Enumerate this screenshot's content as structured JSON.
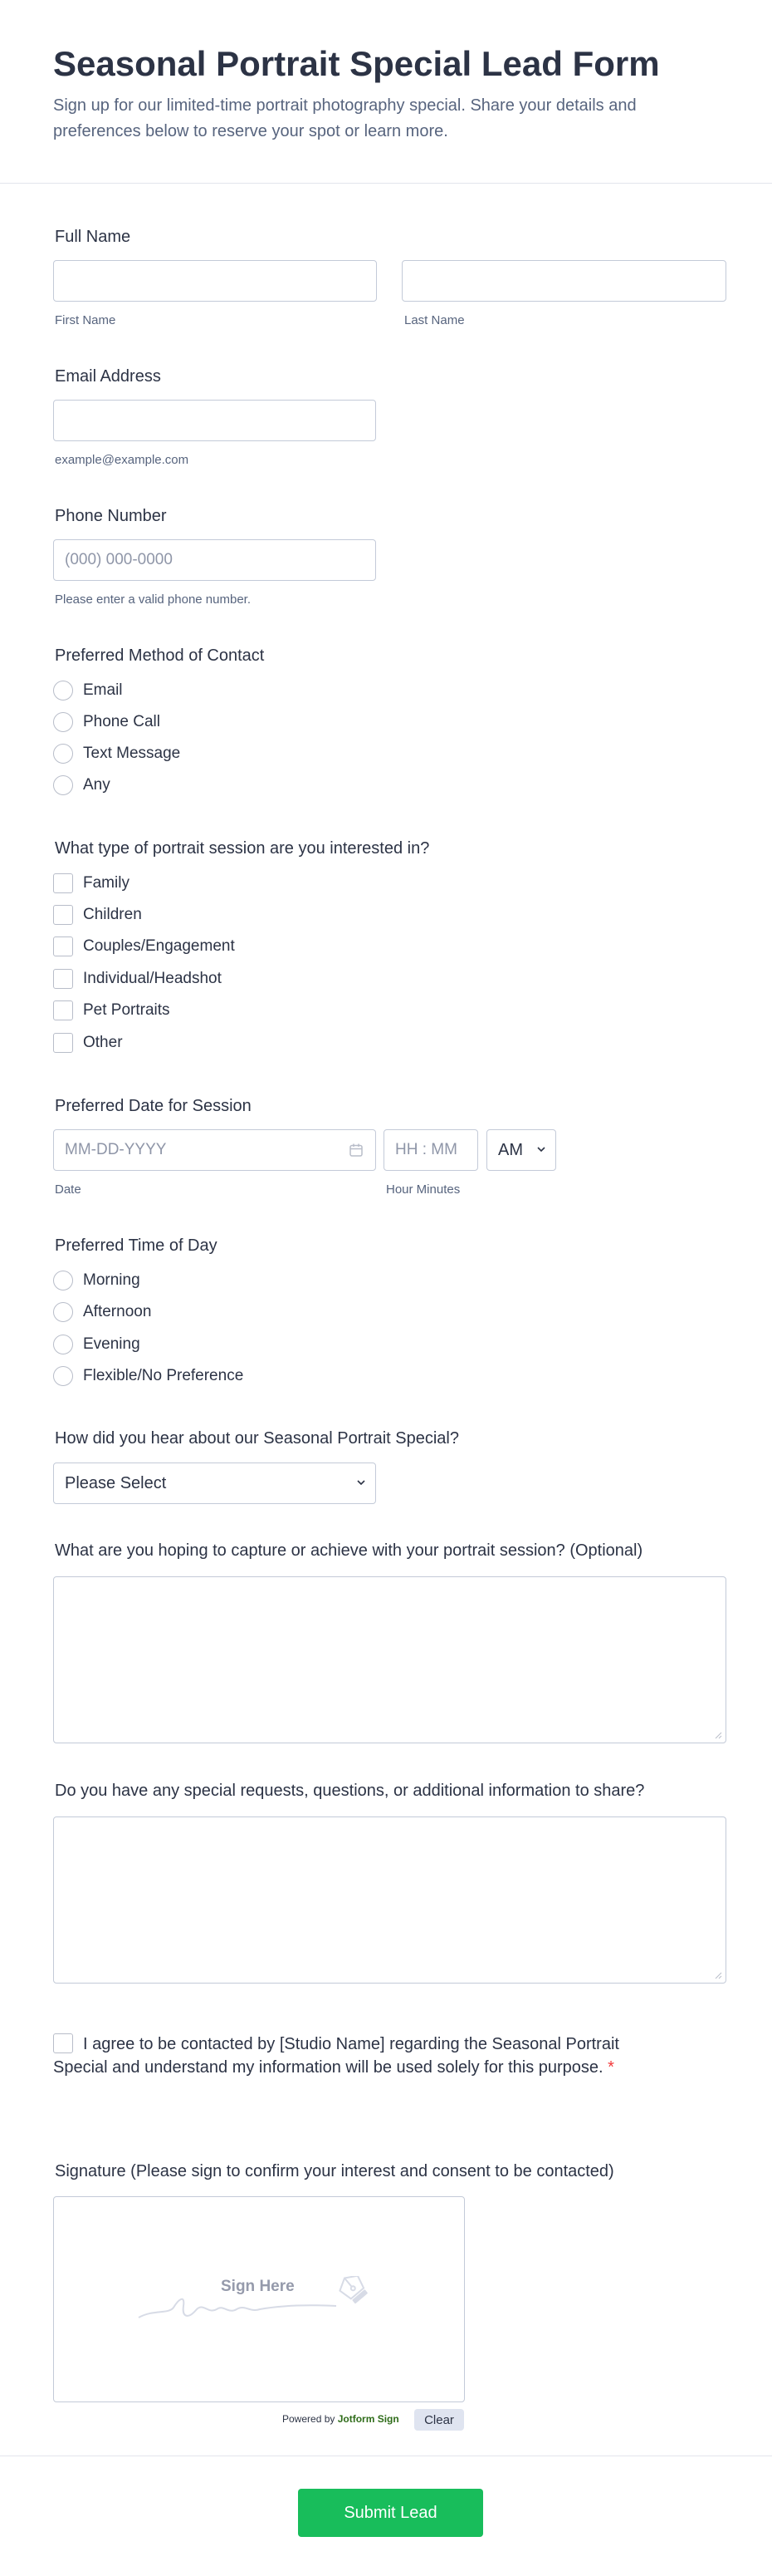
{
  "header": {
    "title": "Seasonal Portrait Special Lead Form",
    "subtitle": "Sign up for our limited-time portrait photography special. Share your details and preferences below to reserve your spot or learn more."
  },
  "full_name": {
    "label": "Full Name",
    "first_sublabel": "First Name",
    "last_sublabel": "Last Name"
  },
  "email": {
    "label": "Email Address",
    "sublabel": "example@example.com"
  },
  "phone": {
    "label": "Phone Number",
    "placeholder": "(000) 000-0000",
    "sublabel": "Please enter a valid phone number."
  },
  "contact_method": {
    "label": "Preferred Method of Contact",
    "options": [
      "Email",
      "Phone Call",
      "Text Message",
      "Any"
    ]
  },
  "session_type": {
    "label": "What type of portrait session are you interested in?",
    "options": [
      "Family",
      "Children",
      "Couples/Engagement",
      "Individual/Headshot",
      "Pet Portraits",
      "Other"
    ]
  },
  "session_date": {
    "label": "Preferred Date for Session",
    "date_placeholder": "MM-DD-YYYY",
    "time_placeholder": "HH : MM",
    "ampm": "AM",
    "date_sublabel": "Date",
    "time_sublabel": "Hour Minutes"
  },
  "time_of_day": {
    "label": "Preferred Time of Day",
    "options": [
      "Morning",
      "Afternoon",
      "Evening",
      "Flexible/No Preference"
    ]
  },
  "referral": {
    "label": "How did you hear about our Seasonal Portrait Special?",
    "selected": "Please Select"
  },
  "goals": {
    "label": "What are you hoping to capture or achieve with your portrait session? (Optional)"
  },
  "requests": {
    "label": "Do you have any special requests, questions, or additional information to share?"
  },
  "consent": {
    "text": "I agree to be contacted by [Studio Name] regarding the Seasonal Portrait Special and understand my information will be used solely for this purpose.",
    "required_mark": "*"
  },
  "signature": {
    "label": "Signature (Please sign to confirm your interest and consent to be contacted)",
    "placeholder": "Sign Here",
    "powered_prefix": "Powered by",
    "powered_brand": "Jotform Sign",
    "clear_label": "Clear"
  },
  "submit_label": "Submit Lead",
  "colors": {
    "accent": "#18bd5b",
    "border": "#c3cad8",
    "text": "#2c3345",
    "muted": "#57647e",
    "required": "#f23a3c"
  }
}
